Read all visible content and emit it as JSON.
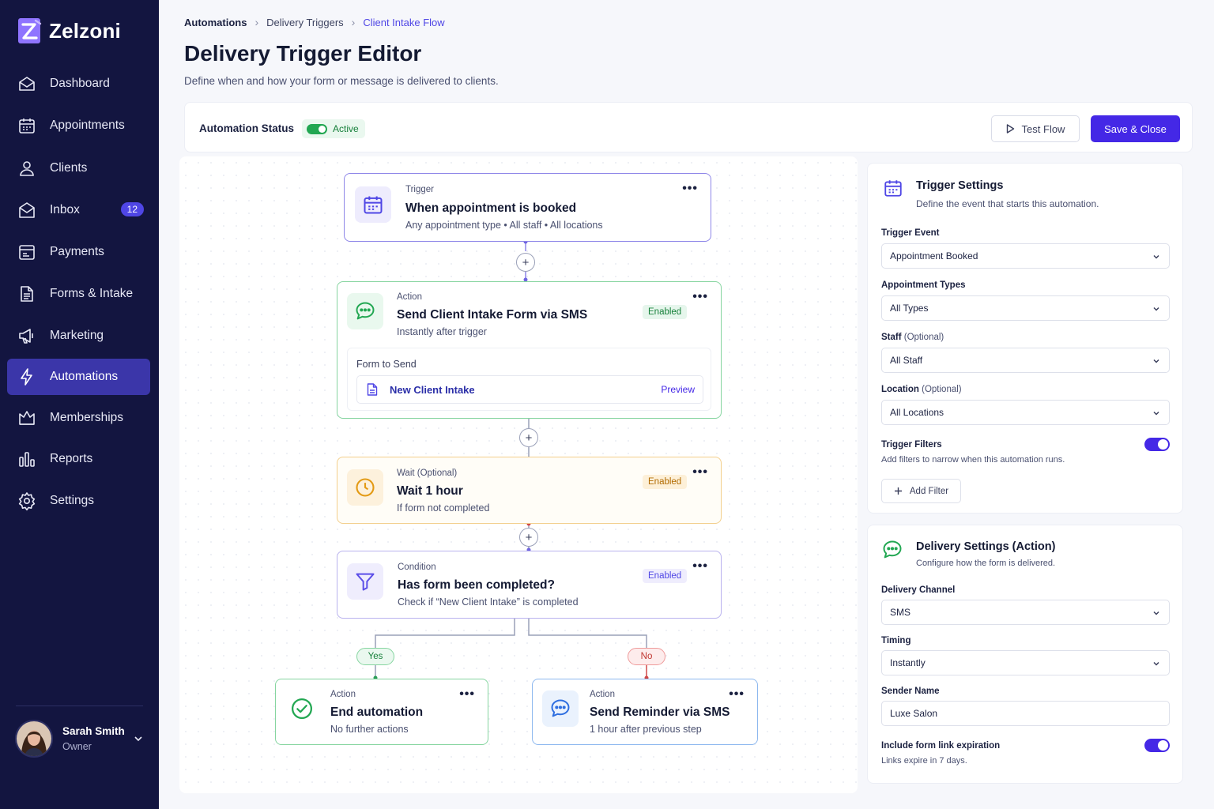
{
  "brand": {
    "name": "Zelzoni"
  },
  "sidebar": {
    "items": [
      {
        "label": "Dashboard",
        "icon": "home-icon"
      },
      {
        "label": "Appointments",
        "icon": "calendar-icon"
      },
      {
        "label": "Clients",
        "icon": "user-icon"
      },
      {
        "label": "Inbox",
        "icon": "inbox-icon",
        "badge": "12"
      },
      {
        "label": "Payments",
        "icon": "wallet-icon"
      },
      {
        "label": "Forms & Intake",
        "icon": "document-icon"
      },
      {
        "label": "Marketing",
        "icon": "megaphone-icon"
      },
      {
        "label": "Automations",
        "icon": "bolt-icon",
        "active": true
      },
      {
        "label": "Memberships",
        "icon": "crown-icon"
      },
      {
        "label": "Reports",
        "icon": "bar-chart-icon"
      },
      {
        "label": "Settings",
        "icon": "gear-icon"
      }
    ],
    "user": {
      "name": "Sarah Smith",
      "role": "Owner"
    }
  },
  "breadcrumb": [
    "Automations",
    "Delivery Triggers",
    "Client Intake Flow"
  ],
  "page": {
    "title": "Delivery Trigger Editor",
    "subtitle": "Define when and how your form or message is delivered to clients."
  },
  "status_bar": {
    "label": "Automation Status",
    "status": "Active",
    "test_button": "Test Flow",
    "save_button": "Save & Close"
  },
  "flow": {
    "trigger": {
      "kind": "Trigger",
      "title": "When appointment is booked",
      "desc": "Any appointment type  •  All staff  •  All locations"
    },
    "action": {
      "kind": "Action",
      "title": "Send Client Intake Form via SMS",
      "desc": "Instantly after trigger",
      "status": "Enabled",
      "form_label": "Form to Send",
      "form_name": "New Client Intake",
      "preview": "Preview"
    },
    "wait": {
      "kind": "Wait (Optional)",
      "title": "Wait 1 hour",
      "desc": "If form not completed",
      "status": "Enabled"
    },
    "condition": {
      "kind": "Condition",
      "title": "Has form been completed?",
      "desc": "Check if “New Client Intake” is completed",
      "status": "Enabled"
    },
    "yes_label": "Yes",
    "no_label": "No",
    "end": {
      "kind": "Action",
      "title": "End automation",
      "desc": "No further actions"
    },
    "reminder": {
      "kind": "Action",
      "title": "Send Reminder via SMS",
      "desc": "1 hour after previous step"
    }
  },
  "trigger_settings": {
    "title": "Trigger Settings",
    "subtitle": "Define the event that starts this automation.",
    "event_label": "Trigger Event",
    "event_value": "Appointment Booked",
    "types_label": "Appointment Types",
    "types_value": "All Types",
    "staff_label": "Staff",
    "staff_opt": "(Optional)",
    "staff_value": "All Staff",
    "location_label": "Location",
    "location_opt": "(Optional)",
    "location_value": "All Locations",
    "filters_label": "Trigger Filters",
    "filters_desc": "Add filters to narrow when this automation runs.",
    "add_filter": "Add Filter"
  },
  "delivery_settings": {
    "title": "Delivery Settings (Action)",
    "subtitle": "Configure how the form is delivered.",
    "channel_label": "Delivery Channel",
    "channel_value": "SMS",
    "timing_label": "Timing",
    "timing_value": "Instantly",
    "sender_label": "Sender Name",
    "sender_value": "Luxe Salon",
    "expiry_label": "Include form link expiration",
    "expiry_desc": "Links expire in 7 days."
  },
  "colors": {
    "sidebar_bg": "#131540",
    "accent": "#4428e6",
    "trigger_border": "#8e86e8",
    "action_border": "#86d5a0",
    "wait_border": "#f3cf8c",
    "condition_border": "#b9b2ee",
    "reminder_border": "#8db8ef"
  }
}
